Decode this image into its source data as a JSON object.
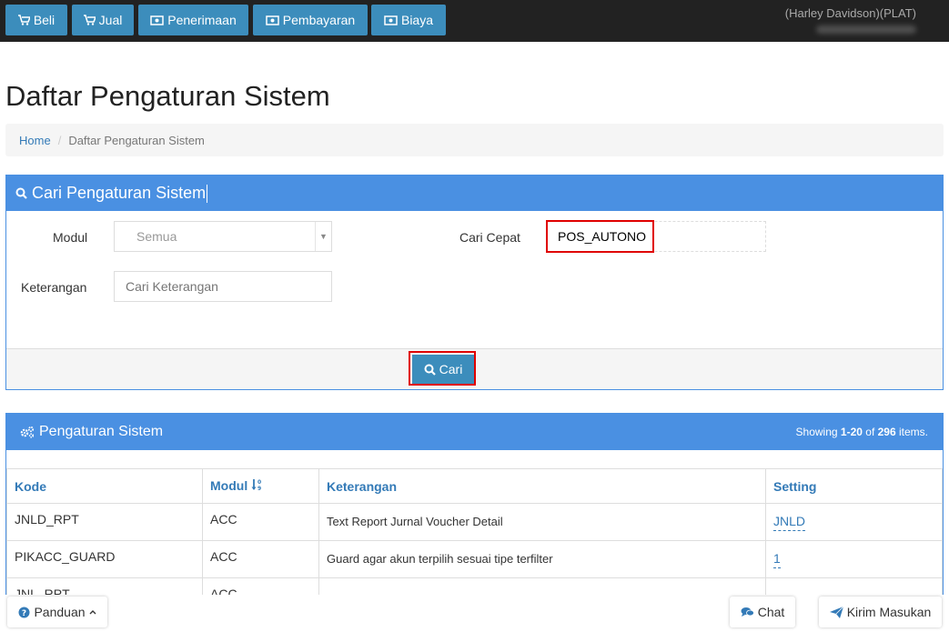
{
  "nav": {
    "buttons": [
      {
        "label": "Beli",
        "icon": "cart-icon"
      },
      {
        "label": "Jual",
        "icon": "cart-icon"
      },
      {
        "label": "Penerimaan",
        "icon": "money-icon"
      },
      {
        "label": "Pembayaran",
        "icon": "money-icon"
      },
      {
        "label": "Biaya",
        "icon": "money-icon"
      }
    ],
    "user_name": "(Harley Davidson)(PLAT)"
  },
  "page": {
    "title": "Daftar Pengaturan Sistem",
    "breadcrumb": {
      "home": "Home",
      "current": "Daftar Pengaturan Sistem"
    }
  },
  "search": {
    "header": "Cari Pengaturan Sistem",
    "modul_label": "Modul",
    "modul_value": "Semua",
    "cari_cepat_label": "Cari Cepat",
    "cari_cepat_value": "POS_AUTONO",
    "keterangan_label": "Keterangan",
    "keterangan_placeholder": "Cari Keterangan",
    "button_label": "Cari"
  },
  "results": {
    "header": "Pengaturan Sistem",
    "summary_prefix": "Showing ",
    "summary_range": "1-20",
    "summary_mid": " of ",
    "summary_total": "296",
    "summary_suffix": " items.",
    "columns": {
      "kode": "Kode",
      "modul": "Modul",
      "keterangan": "Keterangan",
      "setting": "Setting"
    },
    "rows": [
      {
        "kode": "JNLD_RPT",
        "modul": "ACC",
        "keterangan": "Text Report Jurnal Voucher Detail",
        "setting": "JNLD"
      },
      {
        "kode": "PIKACC_GUARD",
        "modul": "ACC",
        "keterangan": "Guard agar akun terpilih sesuai tipe terfilter",
        "setting": "1"
      },
      {
        "kode": "JNL_RPT",
        "modul": "ACC",
        "keterangan": "",
        "setting": ""
      }
    ]
  },
  "footer": {
    "panduan_label": "Panduan",
    "chat_label": "Chat",
    "kirim_label": "Kirim Masukan"
  },
  "colors": {
    "topbar": "#222222",
    "primary": "#3c8dbc",
    "panel_header": "#4a90e2",
    "highlight": "#e00000",
    "link": "#337ab7"
  }
}
